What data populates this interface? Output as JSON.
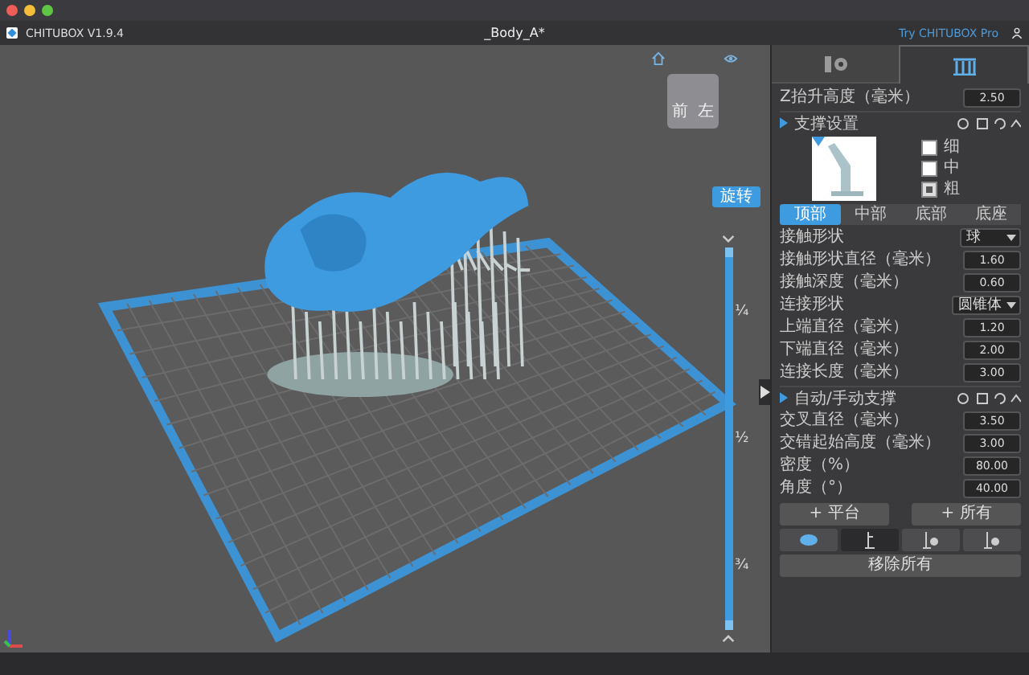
{
  "window": {
    "title": "_Body_A*"
  },
  "app_bar": {
    "app_name": "CHITUBOX V1.9.4",
    "promo_link": "Try CHITUBOX Pro"
  },
  "viewport": {
    "cube_faces": [
      "前",
      "左"
    ],
    "rotate_button": "旋转",
    "layer_slider": {
      "level": 1,
      "ticks": [
        "¼",
        "½",
        "¾"
      ]
    }
  },
  "panel": {
    "tabs": [
      {
        "kind": "settings",
        "selected": false
      },
      {
        "kind": "supports",
        "selected": true
      }
    ],
    "lift_height": {
      "label": "Z抬升高度（毫米）",
      "value": "2.50"
    },
    "support_settings": {
      "title": "支撑设置",
      "density_options": [
        {
          "label": "细",
          "checked": false
        },
        {
          "label": "中",
          "checked": false
        },
        {
          "label": "粗",
          "checked": true
        }
      ],
      "part_tabs": [
        {
          "label": "顶部",
          "selected": true
        },
        {
          "label": "中部",
          "selected": false
        },
        {
          "label": "底部",
          "selected": false
        },
        {
          "label": "底座",
          "selected": false
        }
      ],
      "params": [
        {
          "kind": "select",
          "label": "接触形状",
          "value": "球"
        },
        {
          "kind": "number",
          "label": "接触形状直径（毫米）",
          "value": "1.60"
        },
        {
          "kind": "number",
          "label": "接触深度（毫米）",
          "value": "0.60"
        },
        {
          "kind": "select",
          "label": "连接形状",
          "value": "圆锥体"
        },
        {
          "kind": "number",
          "label": "上端直径（毫米）",
          "value": "1.20"
        },
        {
          "kind": "number",
          "label": "下端直径（毫米）",
          "value": "2.00"
        },
        {
          "kind": "number",
          "label": "连接长度（毫米）",
          "value": "3.00"
        }
      ]
    },
    "auto_support": {
      "title": "自动/手动支撑",
      "params": [
        {
          "kind": "number",
          "label": "交叉直径（毫米）",
          "value": "3.50"
        },
        {
          "kind": "number",
          "label": "交错起始高度（毫米）",
          "value": "3.00"
        },
        {
          "kind": "number",
          "label": "密度（%）",
          "value": "80.00"
        },
        {
          "kind": "number",
          "label": "角度（°）",
          "value": "40.00"
        }
      ],
      "buttons": [
        "+ 平台",
        "+ 所有"
      ]
    },
    "view_toggles": [
      {
        "kind": "eye",
        "selected": false
      },
      {
        "kind": "support",
        "selected": true
      },
      {
        "kind": "support-dot",
        "selected": false
      },
      {
        "kind": "support-dot",
        "selected": false
      }
    ],
    "remove_all": "移除所有"
  }
}
